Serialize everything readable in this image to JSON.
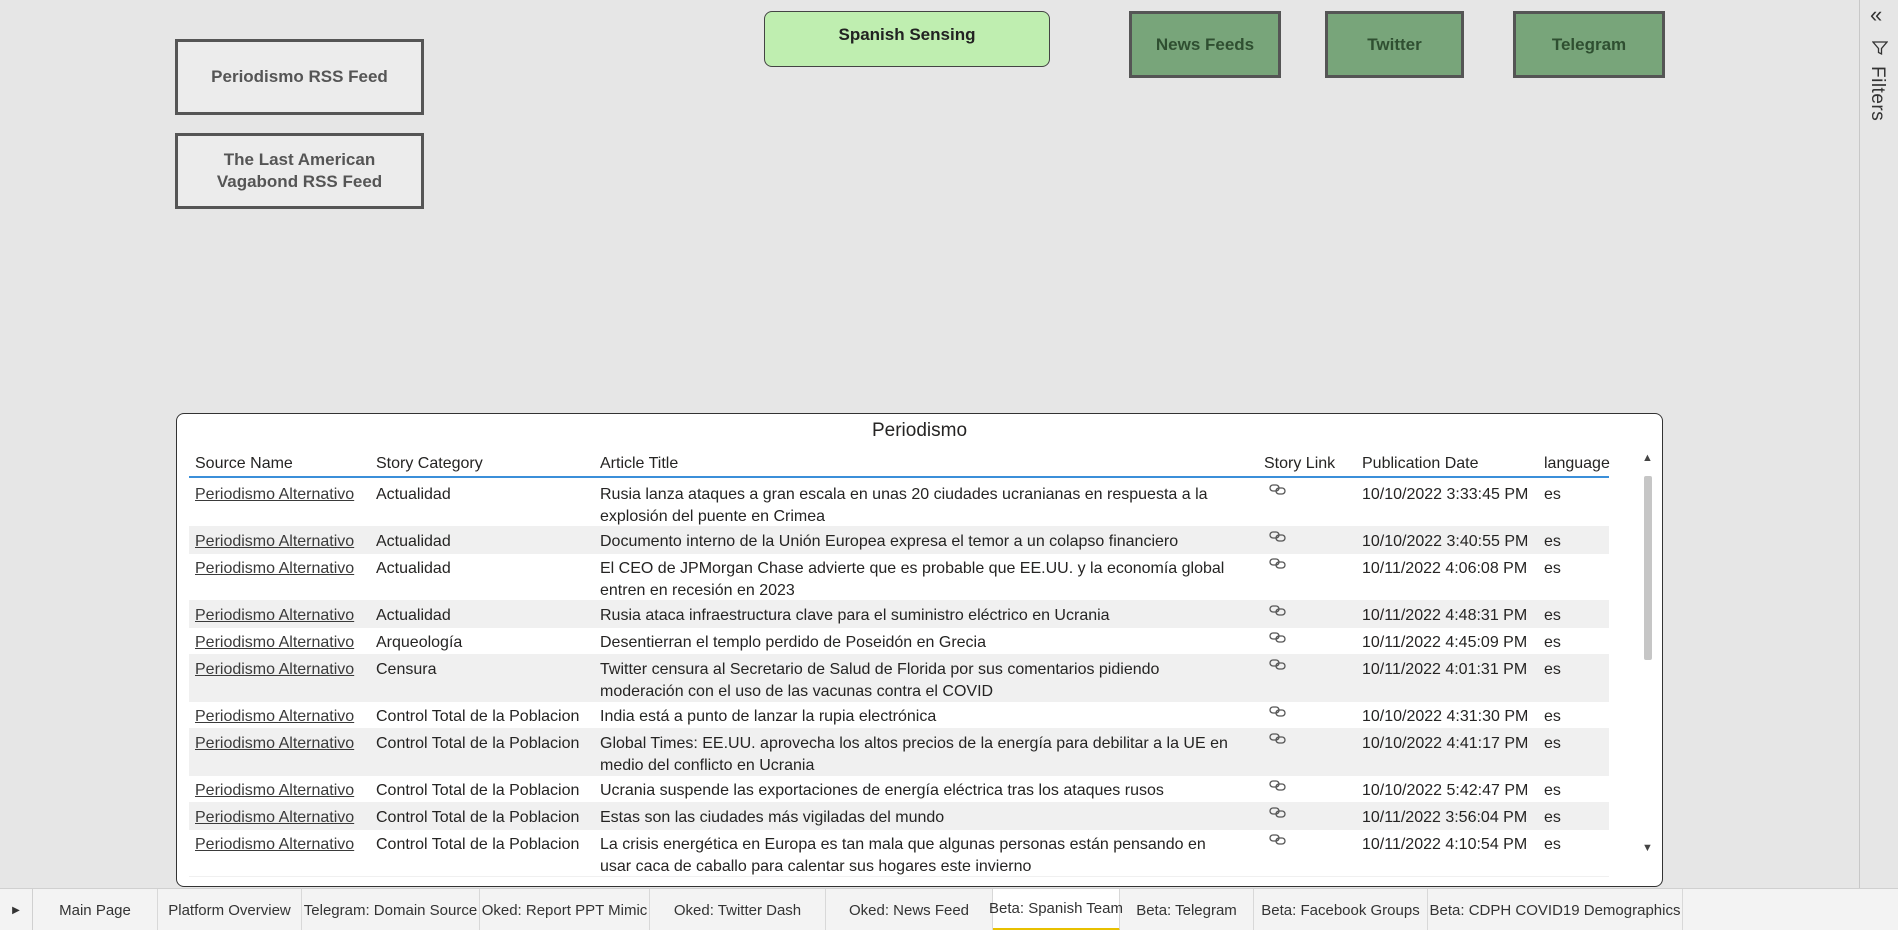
{
  "buttons": {
    "periodismo_rss": "Periodismo RSS Feed",
    "vagabond_rss": "The Last American Vagabond RSS Feed",
    "spanish_sensing": "Spanish Sensing"
  },
  "nav": {
    "news_feeds": "News Feeds",
    "twitter": "Twitter",
    "telegram": "Telegram"
  },
  "filters_pane": {
    "label": "Filters",
    "collapse_icon": "double-chevron-left-icon",
    "filter_icon": "funnel-icon"
  },
  "table": {
    "title": "Periodismo",
    "columns": [
      "Source Name",
      "Story Category",
      "Article Title",
      "Story Link",
      "Publication Date",
      "language"
    ],
    "link_icon": "link-icon",
    "rows": [
      {
        "source": "Periodismo Alternativo",
        "category": "Actualidad",
        "title": "Rusia lanza ataques a gran escala en unas 20 ciudades ucranianas en respuesta a la explosión del puente en Crimea",
        "date": "10/10/2022 3:33:45 PM",
        "lang": "es"
      },
      {
        "source": "Periodismo Alternativo",
        "category": "Actualidad",
        "title": "Documento interno de la Unión Europea expresa el temor a un colapso financiero",
        "date": "10/10/2022 3:40:55 PM",
        "lang": "es"
      },
      {
        "source": "Periodismo Alternativo",
        "category": "Actualidad",
        "title": "El CEO de JPMorgan Chase advierte que es probable que EE.UU. y la economía global entren en recesión en 2023",
        "date": "10/11/2022 4:06:08 PM",
        "lang": "es"
      },
      {
        "source": "Periodismo Alternativo",
        "category": "Actualidad",
        "title": "Rusia ataca infraestructura clave para el suministro eléctrico en Ucrania",
        "date": "10/11/2022 4:48:31 PM",
        "lang": "es"
      },
      {
        "source": "Periodismo Alternativo",
        "category": "Arqueología",
        "title": "Desentierran el templo perdido de Poseidón en Grecia",
        "date": "10/11/2022 4:45:09 PM",
        "lang": "es"
      },
      {
        "source": "Periodismo Alternativo",
        "category": "Censura",
        "title": "Twitter censura al Secretario de Salud de Florida por sus comentarios pidiendo moderación con el uso de las vacunas contra el COVID",
        "date": "10/11/2022 4:01:31 PM",
        "lang": "es"
      },
      {
        "source": "Periodismo Alternativo",
        "category": "Control Total de la Poblacion",
        "title": "India está a punto de lanzar la rupia electrónica",
        "date": "10/10/2022 4:31:30 PM",
        "lang": "es"
      },
      {
        "source": "Periodismo Alternativo",
        "category": "Control Total de la Poblacion",
        "title": "Global Times: EE.UU. aprovecha los altos precios de la energía para debilitar a la UE en medio del conflicto en Ucrania",
        "date": "10/10/2022 4:41:17 PM",
        "lang": "es"
      },
      {
        "source": "Periodismo Alternativo",
        "category": "Control Total de la Poblacion",
        "title": "Ucrania suspende las exportaciones de energía eléctrica tras los ataques rusos",
        "date": "10/10/2022 5:42:47 PM",
        "lang": "es"
      },
      {
        "source": "Periodismo Alternativo",
        "category": "Control Total de la Poblacion",
        "title": "Estas son las ciudades más vigiladas del mundo",
        "date": "10/11/2022 3:56:04 PM",
        "lang": "es"
      },
      {
        "source": "Periodismo Alternativo",
        "category": "Control Total de la Poblacion",
        "title": "La crisis energética en Europa es tan mala que algunas personas están pensando en usar caca de caballo para calentar sus hogares este invierno",
        "date": "10/11/2022 4:10:54 PM",
        "lang": "es"
      }
    ]
  },
  "tabs": [
    {
      "label": "Main Page",
      "active": false
    },
    {
      "label": "Platform Overview",
      "active": false
    },
    {
      "label": "Telegram: Domain Source",
      "active": false
    },
    {
      "label": "Oked: Report PPT Mimic",
      "active": false
    },
    {
      "label": "Oked: Twitter Dash",
      "active": false
    },
    {
      "label": "Oked: News Feed",
      "active": false
    },
    {
      "label": "Beta: Spanish Team",
      "active": true
    },
    {
      "label": "Beta: Telegram",
      "active": false
    },
    {
      "label": "Beta: Facebook Groups",
      "active": false
    },
    {
      "label": "Beta: CDPH COVID19 Demographics",
      "active": false
    }
  ],
  "colors": {
    "canvas": "#e6e6e6",
    "spanish_sensing_fill": "#bfeeb0",
    "nav_fill": "#78a57a",
    "header_underline": "#3b8fd9",
    "active_tab_accent": "#e8c000"
  }
}
